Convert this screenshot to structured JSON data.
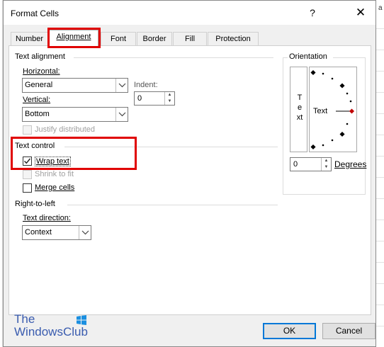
{
  "dialog": {
    "title": "Format Cells",
    "help": "?",
    "close": "✕"
  },
  "tabs": [
    {
      "label": "Number"
    },
    {
      "label": "Alignment"
    },
    {
      "label": "Font"
    },
    {
      "label": "Border"
    },
    {
      "label": "Fill"
    },
    {
      "label": "Protection"
    }
  ],
  "active_tab": "Alignment",
  "text_alignment": {
    "group_title": "Text alignment",
    "horizontal_label": "Horizontal:",
    "horizontal_value": "General",
    "vertical_label": "Vertical:",
    "vertical_value": "Bottom",
    "indent_label": "Indent:",
    "indent_value": "0",
    "justify_distributed": "Justify distributed"
  },
  "text_control": {
    "group_title": "Text control",
    "wrap_text": "Wrap text",
    "wrap_text_checked": true,
    "shrink_to_fit": "Shrink to fit",
    "merge_cells": "Merge cells",
    "merge_cells_checked": false
  },
  "right_to_left": {
    "group_title": "Right-to-left",
    "text_direction_label": "Text direction:",
    "text_direction_value": "Context"
  },
  "orientation": {
    "group_title": "Orientation",
    "vertical_text": "Text",
    "dial_text": "Text",
    "degrees_value": "0",
    "degrees_label": "Degrees"
  },
  "footer": {
    "ok": "OK",
    "cancel": "Cancel"
  },
  "watermark": {
    "line1": "The",
    "line2": "WindowsClub"
  },
  "background": {
    "column_letter": "a"
  },
  "colors": {
    "highlight_red": "#e00000",
    "accent_blue": "#0078d7"
  }
}
